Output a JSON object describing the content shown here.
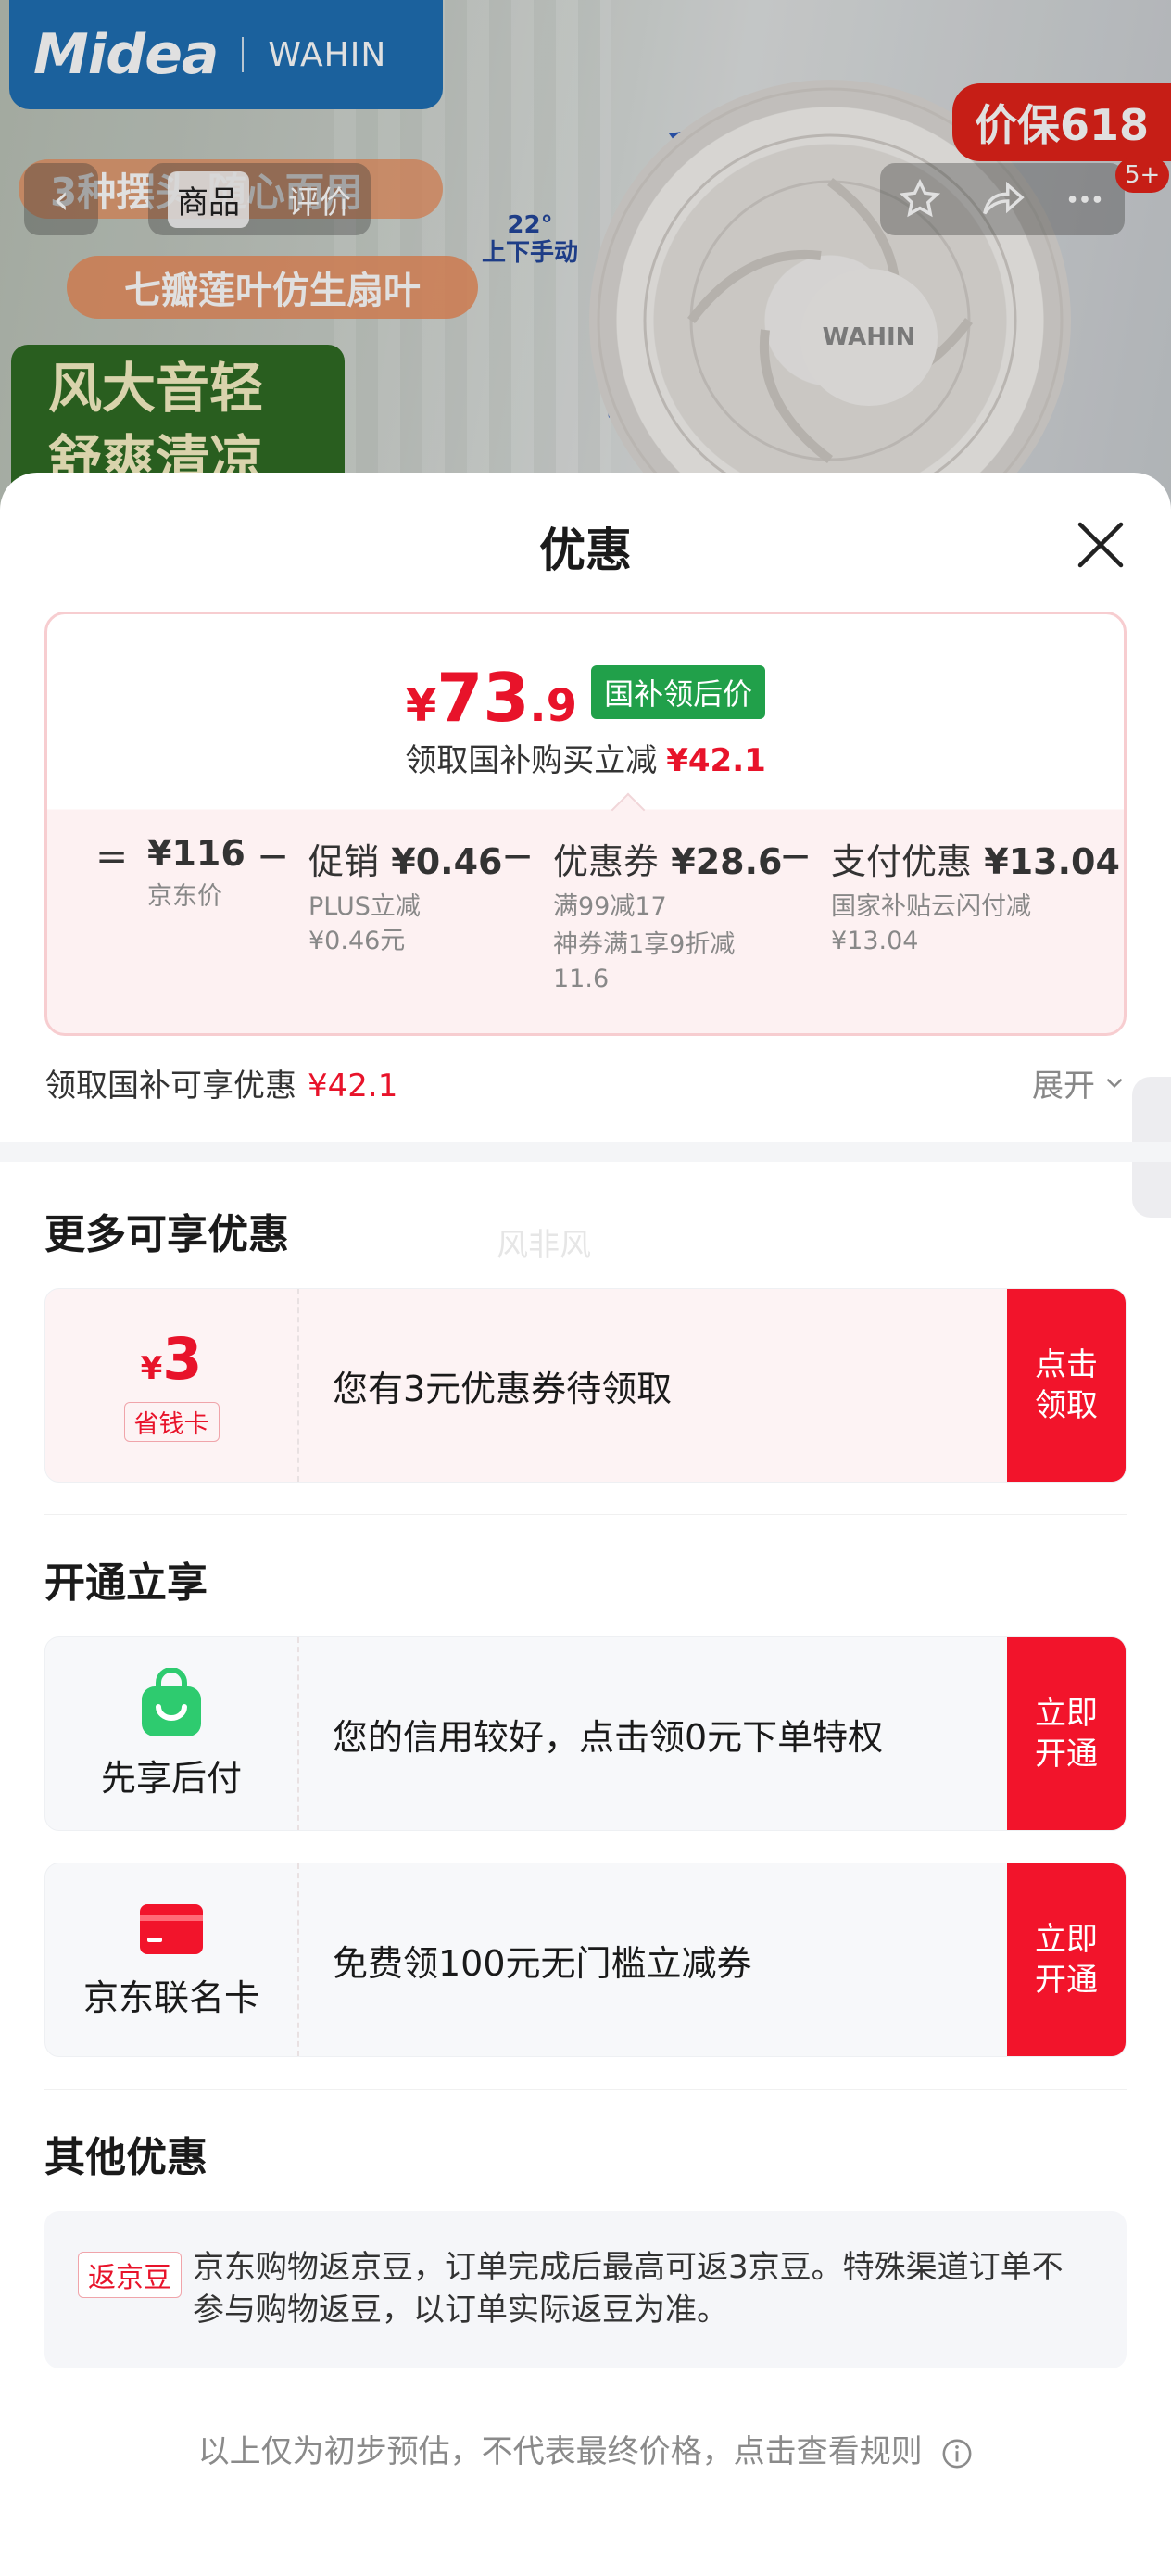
{
  "banner": {
    "brand": "Midea",
    "sub_brand": "WAHIN",
    "promo": "价保618",
    "feature_1": "3种摆头 随心而用",
    "feature_2": "七瓣莲叶仿生扇叶",
    "feature_3_line1": "风大音轻",
    "feature_3_line2": "舒爽清凉",
    "angle_value": "22°",
    "angle_label": "上下手动",
    "fan_logo": "WAHIN"
  },
  "nav": {
    "back": "‹",
    "tabs": [
      "商品",
      "评价"
    ],
    "message_badge": "5+"
  },
  "sheet": {
    "title": "优惠",
    "price": {
      "yen": "¥",
      "int": "73",
      "dec": ".9",
      "tag": "国补领后价",
      "sub_text": "领取国补购买立减",
      "sub_amount": "¥42.1"
    },
    "formula": {
      "eq": "=",
      "minus": "−",
      "items": [
        {
          "main": "¥116",
          "label": "",
          "sub": [
            "京东价"
          ]
        },
        {
          "main": "¥0.46",
          "label": "促销",
          "sub": [
            "PLUS立减",
            "¥0.46元"
          ]
        },
        {
          "main": "¥28.6",
          "label": "优惠券",
          "sub": [
            "满99减17",
            "神券满1享9折减",
            "11.6"
          ]
        },
        {
          "main": "¥13.04",
          "label": "支付优惠",
          "sub": [
            "国家补贴云闪付减",
            "¥13.04"
          ]
        }
      ]
    },
    "summary": {
      "text": "领取国补可享优惠",
      "amount": "¥42.1",
      "expand": "展开"
    },
    "watermark": "风非风",
    "more_title": "更多可享优惠",
    "coupon": {
      "yen": "¥",
      "amount": "3",
      "label": "省钱卡",
      "text": "您有3元优惠券待领取",
      "btn_line1": "点击",
      "btn_line2": "领取"
    },
    "open_title": "开通立享",
    "services": [
      {
        "name": "先享后付",
        "text": "您的信用较好，点击领0元下单特权",
        "btn_line1": "立即",
        "btn_line2": "开通",
        "icon_color": "#2ecb6f"
      },
      {
        "name": "京东联名卡",
        "text": "免费领100元无门槛立减券",
        "btn_line1": "立即",
        "btn_line2": "开通",
        "icon_color": "#f2142b"
      }
    ],
    "other_title": "其他优惠",
    "other": {
      "tag": "返京豆",
      "text": "京东购物返京豆，订单完成后最高可返3京豆。特殊渠道订单不参与购物返豆，以订单实际返豆为准。"
    },
    "footer": "以上仅为初步预估，不代表最终价格，点击查看规则"
  },
  "colors": {
    "accent_red": "#f2142b",
    "price_red": "#e8132a",
    "green_tag": "#21a04a"
  }
}
